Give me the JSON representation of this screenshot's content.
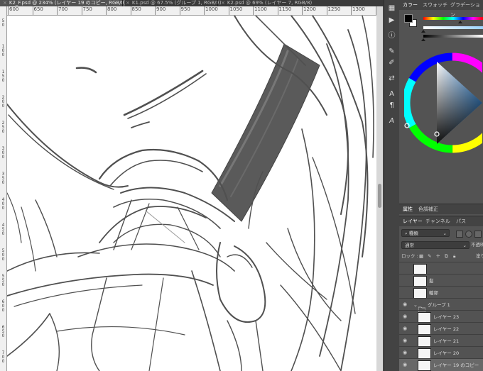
{
  "doc_tabs": [
    {
      "label": "K2_F.psd @ 234% (レイヤー 19 のコピー, RGB/8)",
      "active": true
    },
    {
      "label": "K1.psd @ 67.5% (グループ 1, RGB/8)",
      "active": false
    },
    {
      "label": "K2.psd @ 69% (レイヤー 7, RGB/8)",
      "active": false
    }
  ],
  "ruler": {
    "top_ticks": [
      "600",
      "650",
      "700",
      "750",
      "800",
      "850",
      "900",
      "950",
      "1000",
      "1050",
      "1100",
      "1150",
      "1200",
      "1250",
      "1300",
      "1350"
    ],
    "left_ticks": [
      "50",
      "100",
      "150",
      "200",
      "250",
      "300",
      "350",
      "400",
      "450",
      "500",
      "550",
      "600",
      "650",
      "700"
    ]
  },
  "color_panel": {
    "tabs": [
      "カラー",
      "スウォッチ",
      "グラデーション"
    ],
    "foreground": "#000000",
    "background": "#ffffff",
    "accent": "#4a90e2"
  },
  "props_panel": {
    "tabs": [
      "属性",
      "色調補正"
    ]
  },
  "layers_panel": {
    "tabs": [
      "レイヤー",
      "チャンネル",
      "パス"
    ],
    "filter_label": "種類",
    "blend_mode": "通常",
    "opacity_label": "不透明度",
    "lock_label": "ロック :",
    "fill_label": "塗り",
    "layers": [
      {
        "name": "",
        "visible": false,
        "indent": 0,
        "type": "layer",
        "selected": false
      },
      {
        "name": "髪",
        "visible": false,
        "indent": 0,
        "type": "layer",
        "selected": false
      },
      {
        "name": "輪郭",
        "visible": false,
        "indent": 0,
        "type": "layer",
        "selected": false
      },
      {
        "name": "グループ 1",
        "visible": true,
        "indent": 0,
        "type": "group",
        "selected": false
      },
      {
        "name": "レイヤー 23",
        "visible": true,
        "indent": 1,
        "type": "layer",
        "selected": false
      },
      {
        "name": "レイヤー 22",
        "visible": true,
        "indent": 1,
        "type": "layer",
        "selected": false
      },
      {
        "name": "レイヤー 21",
        "visible": true,
        "indent": 1,
        "type": "layer",
        "selected": false
      },
      {
        "name": "レイヤー 20",
        "visible": true,
        "indent": 1,
        "type": "layer",
        "selected": false
      },
      {
        "name": "レイヤー 19 のコピー",
        "visible": true,
        "indent": 1,
        "type": "layer",
        "selected": true
      }
    ]
  },
  "tools": [
    "arrange-icon",
    "play-icon",
    "info-icon",
    "brush-settings-icon",
    "brush-icon",
    "adjust-icon",
    "character-icon",
    "paragraph-icon",
    "glyph-icon"
  ]
}
